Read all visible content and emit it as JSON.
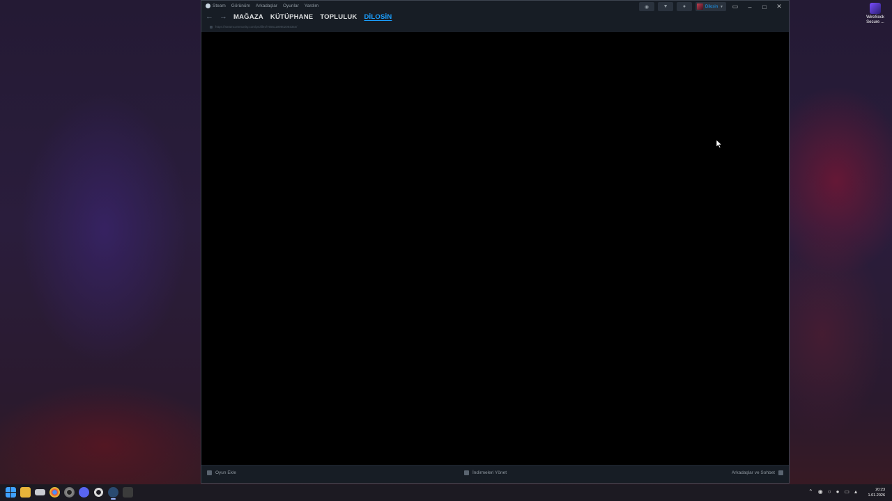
{
  "desktop": {
    "icon_label": "WireSock Secure ..."
  },
  "steam": {
    "menu": [
      "Steam",
      "Görünüm",
      "Arkadaşlar",
      "Oyunlar",
      "Yardım"
    ],
    "nav_tabs": [
      "MAĞAZA",
      "KÜTÜPHANE",
      "TOPLULUK",
      "DİLOSİN"
    ],
    "url": "https://steamcommunity.com/profiles/76561199802084354/",
    "username": "Dilosin",
    "footer": {
      "add_game": "Oyun Ekle",
      "manage_downloads": "İndirmeleri Yönet",
      "friends_chat": "Arkadaşlar ve Sohbet"
    },
    "colors": {
      "accent": "#1a9fff",
      "frame": "#171d25",
      "content": "#000000"
    }
  },
  "taskbar": {
    "time": "20:23",
    "date": "1.01.2026"
  }
}
